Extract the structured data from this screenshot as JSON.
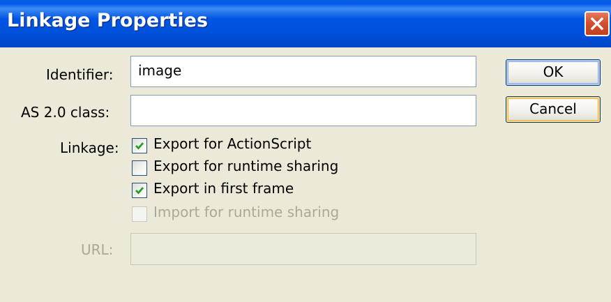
{
  "window": {
    "title": "Linkage Properties",
    "close_icon": "close-icon"
  },
  "form": {
    "identifier_label": "Identifier:",
    "identifier_value": "image",
    "class_label": "AS 2.0 class:",
    "class_value": "",
    "linkage_label": "Linkage:",
    "url_label": "URL:",
    "url_value": ""
  },
  "options": [
    {
      "label": "Export for ActionScript",
      "checked": true,
      "enabled": true
    },
    {
      "label": "Export for runtime sharing",
      "checked": false,
      "enabled": true
    },
    {
      "label": "Export in first frame",
      "checked": true,
      "enabled": true
    },
    {
      "label": "Import for runtime sharing",
      "checked": false,
      "enabled": false
    }
  ],
  "buttons": {
    "ok_label": "OK",
    "cancel_label": "Cancel"
  },
  "colors": {
    "titlebar": "#0054e3",
    "dialog_bg": "#ece9d8",
    "checkmark": "#21a121",
    "close_button": "#d4502f"
  }
}
